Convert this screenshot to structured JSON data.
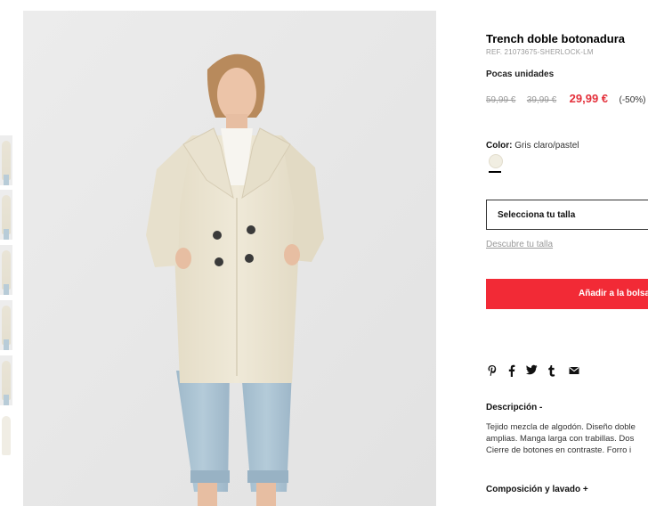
{
  "product": {
    "title": "Trench doble botonadura",
    "reference": "REF. 21073675-SHERLOCK-LM",
    "stock_notice": "Pocas unidades",
    "prices": {
      "original_1": "59,99 €",
      "original_2": "39,99 €",
      "current": "29,99 €",
      "discount": "(-50%)"
    },
    "color": {
      "label": "Color:",
      "value": "Gris claro/pastel",
      "swatch_hex": "#f1eee2"
    },
    "size_select": {
      "label": "Selecciona tu talla"
    },
    "size_guide_link": "Descubre tu talla",
    "add_to_bag": "Añadir a la bolsa",
    "share_icons": [
      "pinterest-icon",
      "facebook-icon",
      "twitter-icon",
      "tumblr-icon",
      "email-icon"
    ],
    "description": {
      "title": "Descripción",
      "toggle": "-",
      "lines": [
        "Tejido mezcla de algodón. Diseño doble",
        "amplias. Manga larga con trabillas. Dos",
        "Cierre de botones en contraste. Forro i"
      ]
    },
    "composition": {
      "title": "Composición y lavado",
      "toggle": "+"
    }
  },
  "gallery": {
    "thumbnail_count": 6
  },
  "colors": {
    "accent": "#f22a36",
    "sale_price": "#e4303b",
    "coat": "#ece6d4",
    "trousers": "#a9c3d3"
  }
}
